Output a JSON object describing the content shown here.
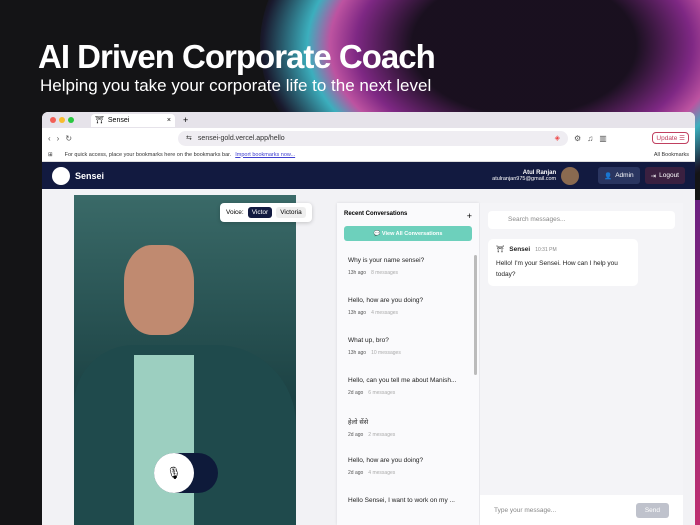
{
  "hero": {
    "title": "AI Driven Corporate Coach",
    "subtitle": "Helping you take your corporate life to the next level"
  },
  "browser": {
    "tab_title": "Sensei",
    "url": "sensei-gold.vercel.app/hello",
    "update": "Update",
    "bookmarks_hint": "For quick access, place your bookmarks here on the bookmarks bar.",
    "import_link": "Import bookmarks now...",
    "all_bookmarks": "All Bookmarks"
  },
  "nav": {
    "brand": "Sensei",
    "user_name": "Atul Ranjan",
    "user_email": "atulranjan975@gmail.com",
    "admin": "Admin",
    "logout": "Logout"
  },
  "voice": {
    "label": "Voice:",
    "options": [
      "Victor",
      "Victoria"
    ]
  },
  "conversations": {
    "title": "Recent Conversations",
    "view_all": "View All Conversations",
    "items": [
      {
        "title": "Why is your name sensei?",
        "time": "13h ago",
        "count": "8 messages"
      },
      {
        "title": "Hello, how are you doing?",
        "time": "13h ago",
        "count": "4 messages"
      },
      {
        "title": "What up, bro?",
        "time": "13h ago",
        "count": "10 messages"
      },
      {
        "title": "Hello, can you tell me about Manish...",
        "time": "2d ago",
        "count": "6 messages"
      },
      {
        "title": "हेलो सेंसे",
        "time": "2d ago",
        "count": "2 messages"
      },
      {
        "title": "Hello, how are you doing?",
        "time": "2d ago",
        "count": "4 messages"
      },
      {
        "title": "Hello Sensei, I want to work on my ...",
        "time": "",
        "count": ""
      }
    ]
  },
  "chat": {
    "search_placeholder": "Search messages...",
    "message": {
      "sender": "Sensei",
      "time": "10:31 PM",
      "text": "Hello! I'm your Sensei. How can I help you today?"
    },
    "input_placeholder": "Type your message...",
    "send": "Send"
  }
}
